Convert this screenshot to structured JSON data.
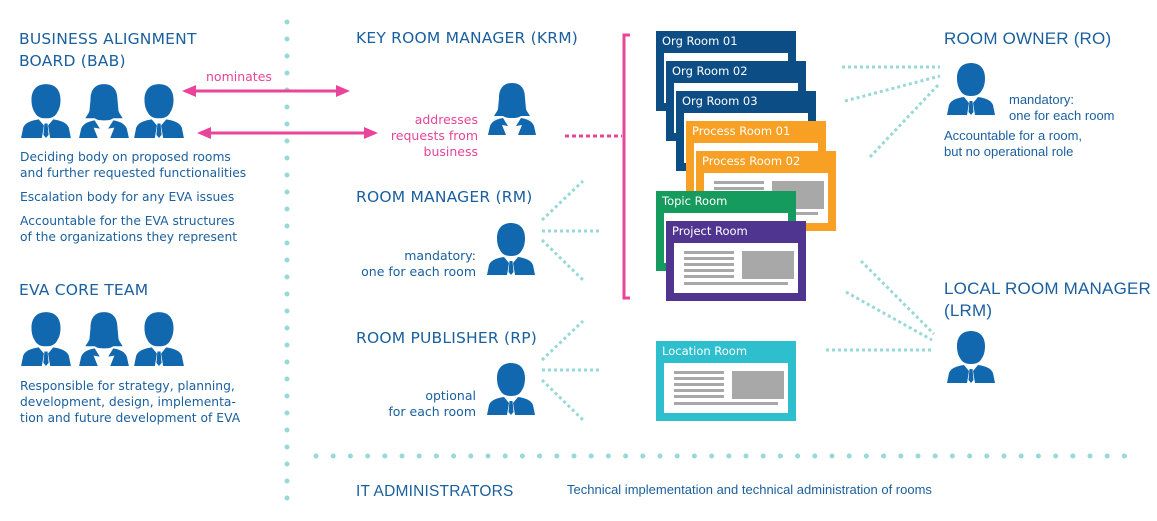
{
  "colors": {
    "primary_blue": "#1268ae",
    "text_blue": "#1a5f9e",
    "pink": "#e8449a",
    "teal_dots": "#96d9d6",
    "org_room": "#0d4d86",
    "process_room": "#f7a023",
    "topic_room": "#169b5f",
    "project_room": "#503590",
    "location_room": "#2ebfcf",
    "placeholder_gray": "#a8a8a8"
  },
  "bab": {
    "title_line1": "BUSINESS ALIGNMENT",
    "title_line2": "BOARD (BAB)",
    "icons": [
      "person-male-icon",
      "person-female-icon",
      "person-male-icon"
    ],
    "desc": [
      [
        "Deciding body on proposed rooms",
        "and further requested functionalities"
      ],
      [
        "Escalation body for any EVA issues"
      ],
      [
        "Accountable for the EVA structures",
        "of the organizations they represent"
      ]
    ]
  },
  "core_team": {
    "title": "EVA CORE TEAM",
    "icons": [
      "person-male-icon",
      "person-female-icon",
      "person-male-icon"
    ],
    "desc": [
      "Responsible for strategy, planning,",
      "development, design, implementa-",
      "tion and future development of EVA"
    ]
  },
  "arrows": {
    "nominates_label": "nominates"
  },
  "krm": {
    "title": "KEY ROOM MANAGER (KRM)",
    "icon": "person-female-icon",
    "note": [
      "addresses",
      "requests from",
      "business"
    ]
  },
  "rm": {
    "title": "ROOM MANAGER (RM)",
    "icon": "person-male-icon",
    "note": [
      "mandatory:",
      "one for each room"
    ]
  },
  "rp": {
    "title": "ROOM PUBLISHER (RP)",
    "icon": "person-male-icon",
    "note": [
      "optional",
      "for each room"
    ]
  },
  "rooms": {
    "org": [
      "Org Room 01",
      "Org Room 02",
      "Org Room 03"
    ],
    "process": [
      "Process Room 01",
      "Process Room 02"
    ],
    "topic": "Topic Room",
    "project": "Project Room",
    "location": "Location Room"
  },
  "ro": {
    "title": "ROOM OWNER (RO)",
    "icon": "person-male-icon",
    "note": [
      "mandatory:",
      "one for each room"
    ],
    "desc": [
      "Accountable for a room,",
      "but no operational role"
    ]
  },
  "lrm": {
    "title_line1": "LOCAL ROOM MANAGER",
    "title_line2": "(LRM)",
    "icon": "person-male-icon"
  },
  "it": {
    "title": "IT ADMINISTRATORS",
    "desc": "Technical implementation and technical administration of rooms"
  }
}
